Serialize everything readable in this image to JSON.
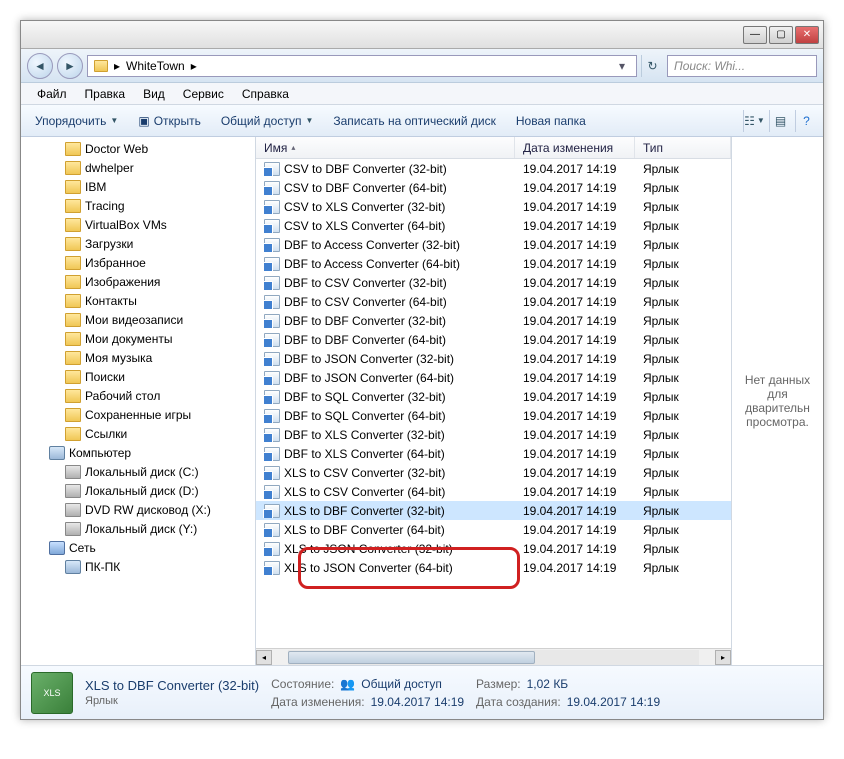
{
  "window": {
    "title_path": "WhiteTown",
    "search_placeholder": "Поиск: Whi..."
  },
  "menu": {
    "file": "Файл",
    "edit": "Правка",
    "view": "Вид",
    "tools": "Сервис",
    "help": "Справка"
  },
  "toolbar": {
    "organize": "Упорядочить",
    "open": "Открыть",
    "share": "Общий доступ",
    "burn": "Записать на оптический диск",
    "new_folder": "Новая папка"
  },
  "columns": {
    "name": "Имя",
    "date": "Дата изменения",
    "type": "Тип"
  },
  "tree": [
    {
      "label": "Doctor Web",
      "icon": "ic-folder",
      "level": 3
    },
    {
      "label": "dwhelper",
      "icon": "ic-folder",
      "level": 3
    },
    {
      "label": "IBM",
      "icon": "ic-folder",
      "level": 3
    },
    {
      "label": "Tracing",
      "icon": "ic-folder",
      "level": 3
    },
    {
      "label": "VirtualBox VMs",
      "icon": "ic-folder",
      "level": 3
    },
    {
      "label": "Загрузки",
      "icon": "ic-folder",
      "level": 3
    },
    {
      "label": "Избранное",
      "icon": "ic-folder",
      "level": 3
    },
    {
      "label": "Изображения",
      "icon": "ic-folder",
      "level": 3
    },
    {
      "label": "Контакты",
      "icon": "ic-folder",
      "level": 3
    },
    {
      "label": "Мои видеозаписи",
      "icon": "ic-folder",
      "level": 3
    },
    {
      "label": "Мои документы",
      "icon": "ic-folder",
      "level": 3
    },
    {
      "label": "Моя музыка",
      "icon": "ic-folder",
      "level": 3
    },
    {
      "label": "Поиски",
      "icon": "ic-folder",
      "level": 3
    },
    {
      "label": "Рабочий стол",
      "icon": "ic-folder",
      "level": 3
    },
    {
      "label": "Сохраненные игры",
      "icon": "ic-folder",
      "level": 3
    },
    {
      "label": "Ссылки",
      "icon": "ic-folder",
      "level": 3
    },
    {
      "label": "Компьютер",
      "icon": "ic-comp",
      "level": 2
    },
    {
      "label": "Локальный диск (C:)",
      "icon": "ic-disk",
      "level": 3
    },
    {
      "label": "Локальный диск (D:)",
      "icon": "ic-disk",
      "level": 3
    },
    {
      "label": "DVD RW дисковод (X:)",
      "icon": "ic-disk",
      "level": 3
    },
    {
      "label": "Локальный диск (Y:)",
      "icon": "ic-disk",
      "level": 3
    },
    {
      "label": "Сеть",
      "icon": "ic-net",
      "level": 2
    },
    {
      "label": "ПК-ПК",
      "icon": "ic-comp",
      "level": 3
    }
  ],
  "files": [
    {
      "name": "CSV to DBF Converter (32-bit)",
      "date": "19.04.2017 14:19",
      "type": "Ярлык"
    },
    {
      "name": "CSV to DBF Converter (64-bit)",
      "date": "19.04.2017 14:19",
      "type": "Ярлык"
    },
    {
      "name": "CSV to XLS Converter (32-bit)",
      "date": "19.04.2017 14:19",
      "type": "Ярлык"
    },
    {
      "name": "CSV to XLS Converter (64-bit)",
      "date": "19.04.2017 14:19",
      "type": "Ярлык"
    },
    {
      "name": "DBF to Access Converter (32-bit)",
      "date": "19.04.2017 14:19",
      "type": "Ярлык"
    },
    {
      "name": "DBF to Access Converter (64-bit)",
      "date": "19.04.2017 14:19",
      "type": "Ярлык"
    },
    {
      "name": "DBF to CSV Converter (32-bit)",
      "date": "19.04.2017 14:19",
      "type": "Ярлык"
    },
    {
      "name": "DBF to CSV Converter (64-bit)",
      "date": "19.04.2017 14:19",
      "type": "Ярлык"
    },
    {
      "name": "DBF to DBF Converter (32-bit)",
      "date": "19.04.2017 14:19",
      "type": "Ярлык"
    },
    {
      "name": "DBF to DBF Converter (64-bit)",
      "date": "19.04.2017 14:19",
      "type": "Ярлык"
    },
    {
      "name": "DBF to JSON Converter (32-bit)",
      "date": "19.04.2017 14:19",
      "type": "Ярлык"
    },
    {
      "name": "DBF to JSON Converter (64-bit)",
      "date": "19.04.2017 14:19",
      "type": "Ярлык"
    },
    {
      "name": "DBF to SQL Converter (32-bit)",
      "date": "19.04.2017 14:19",
      "type": "Ярлык"
    },
    {
      "name": "DBF to SQL Converter (64-bit)",
      "date": "19.04.2017 14:19",
      "type": "Ярлык"
    },
    {
      "name": "DBF to XLS Converter (32-bit)",
      "date": "19.04.2017 14:19",
      "type": "Ярлык"
    },
    {
      "name": "DBF to XLS Converter (64-bit)",
      "date": "19.04.2017 14:19",
      "type": "Ярлык"
    },
    {
      "name": "XLS to CSV Converter (32-bit)",
      "date": "19.04.2017 14:19",
      "type": "Ярлык"
    },
    {
      "name": "XLS to CSV Converter (64-bit)",
      "date": "19.04.2017 14:19",
      "type": "Ярлык"
    },
    {
      "name": "XLS to DBF Converter (32-bit)",
      "date": "19.04.2017 14:19",
      "type": "Ярлык",
      "selected": true
    },
    {
      "name": "XLS to DBF Converter (64-bit)",
      "date": "19.04.2017 14:19",
      "type": "Ярлык"
    },
    {
      "name": "XLS to JSON Converter (32-bit)",
      "date": "19.04.2017 14:19",
      "type": "Ярлык"
    },
    {
      "name": "XLS to JSON Converter (64-bit)",
      "date": "19.04.2017 14:19",
      "type": "Ярлык"
    }
  ],
  "preview": {
    "empty": "Нет данных для дварительн просмотра."
  },
  "details": {
    "title": "XLS to DBF Converter (32-bit)",
    "subtitle": "Ярлык",
    "state_label": "Состояние:",
    "state_value": "Общий доступ",
    "mod_label": "Дата изменения:",
    "mod_value": "19.04.2017 14:19",
    "size_label": "Размер:",
    "size_value": "1,02 КБ",
    "created_label": "Дата создания:",
    "created_value": "19.04.2017 14:19"
  }
}
